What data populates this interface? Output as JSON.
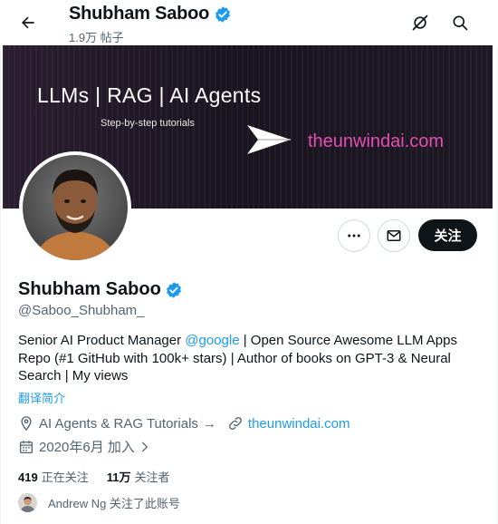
{
  "header": {
    "title": "Shubham Saboo",
    "post_count": "1.9万 帖子"
  },
  "banner": {
    "title": "LLMs | RAG | AI Agents",
    "subtitle": "Step-by-step tutorials",
    "url": "theunwindai.com"
  },
  "actions": {
    "follow_label": "关注"
  },
  "profile": {
    "name": "Shubham Saboo",
    "handle": "@Saboo_Shubham_",
    "bio_prefix": "Senior AI Product Manager ",
    "bio_mention": "@google",
    "bio_rest": " | Open Source Awesome LLM Apps Repo (#1 GitHub with 100k+ stars) | Author of books on GPT-3 & Neural Search | My views",
    "translate_label": "翻译简介",
    "category": "AI Agents & RAG Tutorials",
    "category_arrow": "→",
    "website": "theunwindai.com",
    "joined": "2020年6月 加入",
    "following_count": "419",
    "following_label": "正在关注",
    "followers_count": "11万",
    "followers_label": "关注者",
    "followed_by_text": "Andrew Ng 关注了此账号"
  },
  "colors": {
    "accent": "#1d9bf0",
    "text": "#0f1419",
    "secondary": "#536471",
    "banner_url": "#e04fb1",
    "follow_button": "#0f1419"
  },
  "icons": {
    "back": "arrow-left-icon",
    "verified": "verified-badge-icon",
    "grok": "grok-icon",
    "search": "search-icon",
    "more": "more-icon",
    "message": "envelope-icon",
    "location": "location-pin-icon",
    "link": "link-icon",
    "calendar": "calendar-icon"
  }
}
